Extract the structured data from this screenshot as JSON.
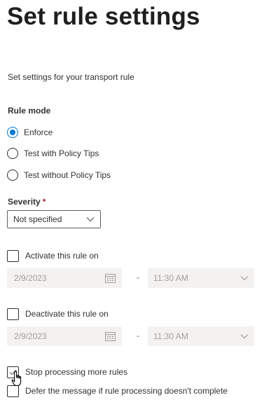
{
  "page": {
    "title": "Set rule settings",
    "subtitle": "Set settings for your transport rule"
  },
  "rule_mode": {
    "label": "Rule mode",
    "options": [
      {
        "label": "Enforce",
        "selected": true
      },
      {
        "label": "Test with Policy Tips",
        "selected": false
      },
      {
        "label": "Test without Policy Tips",
        "selected": false
      }
    ]
  },
  "severity": {
    "label": "Severity",
    "required_marker": "*",
    "value": "Not specified"
  },
  "activate": {
    "label": "Activate this rule on",
    "checked": false,
    "date": "2/9/2023",
    "separator": "-",
    "time": "11:30 AM"
  },
  "deactivate": {
    "label": "Deactivate this rule on",
    "checked": false,
    "date": "2/9/2023",
    "separator": "-",
    "time": "11:30 AM"
  },
  "stop_processing": {
    "label": "Stop processing more rules",
    "checked": false
  },
  "defer": {
    "label": "Defer the message if rule processing doesn't complete",
    "checked": false
  },
  "colors": {
    "accent": "#0078d4",
    "required": "#a4262c",
    "disabled_bg": "#f3f2f1",
    "disabled_text": "#a19f9d"
  },
  "icons": {
    "calendar": "calendar-icon",
    "chevron": "chevron-down-icon",
    "cursor": "hand-pointer-icon"
  }
}
